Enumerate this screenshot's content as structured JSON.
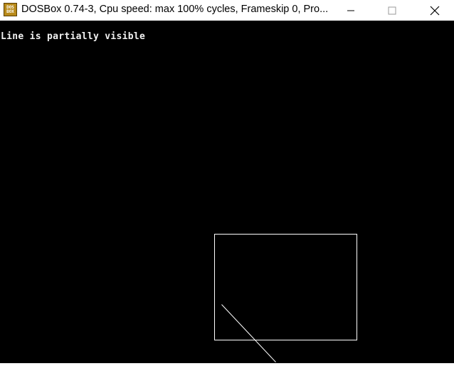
{
  "window": {
    "title": "DOSBox 0.74-3, Cpu speed: max 100% cycles, Frameskip  0, Pro...",
    "icon_lines": [
      "DOS",
      "BOX"
    ],
    "icon": "dosbox-icon"
  },
  "controls": {
    "minimize_icon": "minimize-icon",
    "maximize_icon": "maximize-icon",
    "close_icon": "close-icon"
  },
  "screen": {
    "message": "Line is partially visible",
    "background": "#000000",
    "foreground": "#ffffff"
  }
}
